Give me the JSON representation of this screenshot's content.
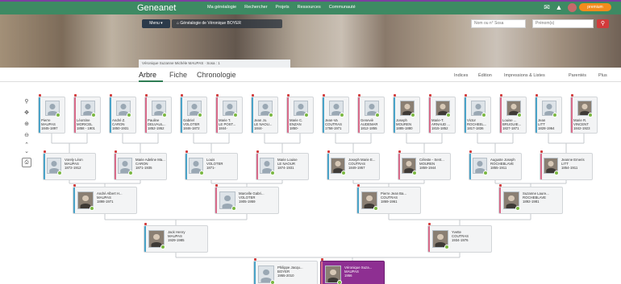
{
  "topbar": {
    "logo": "Geneanet",
    "nav": [
      "Ma généalogie",
      "Rechercher",
      "Projets",
      "Ressources",
      "Communauté"
    ],
    "premium": "premium"
  },
  "banner": {
    "menu_label": "Menu",
    "tree_title": "Généalogie de Véronique BOYER",
    "sosa_placeholder": "Nom ou n° Sosa",
    "prenom_placeholder": "Prénom(s)",
    "person_chip": "Véronique Suzanne Michèle MAUPAS · Sosa : 1"
  },
  "tabs": {
    "left": [
      "Arbre",
      "Fiche",
      "Chronologie"
    ],
    "right": [
      "Indices",
      "Édition",
      "Impressions & Listes",
      "Parentés",
      "Plus"
    ]
  },
  "tools": {
    "zoom_in": "⚲",
    "recenter": "✥",
    "zoom_plus": "⊕",
    "zoom_minus": "⊖",
    "up": "⌃",
    "down": "⌄",
    "print": "⎙"
  },
  "gen4": [
    {
      "l1": "Pierre",
      "l2": "MAUPAS",
      "l3": "1845-1897",
      "sex": "male"
    },
    {
      "l1": "Léontine",
      "l2": "MORICEL",
      "l3": "1858 - 1901",
      "sex": "female"
    },
    {
      "l1": "André Z.",
      "l2": "CARON",
      "l3": "1850-1931",
      "sex": "male"
    },
    {
      "l1": "Pauline",
      "l2": "DELVAUL...",
      "l3": "1852-1952",
      "sex": "female"
    },
    {
      "l1": "Gabriel",
      "l2": "VOLOTER",
      "l3": "1846-1872",
      "sex": "male"
    },
    {
      "l1": "Marie T.",
      "l2": "LE POST...",
      "l3": "1844-",
      "sex": "female"
    },
    {
      "l1": "Jean Jo.",
      "l2": "LE NAOU...",
      "l3": "1844-",
      "sex": "male"
    },
    {
      "l1": "Marie C.",
      "l2": "ENZAN",
      "l3": "1850-",
      "sex": "female"
    },
    {
      "l1": "Jean-Va",
      "l2": "COUTRAS",
      "l3": "1758-1971",
      "sex": "male"
    },
    {
      "l1": "Geneviè",
      "l2": "AUDEMAR",
      "l3": "1812-1855",
      "sex": "female"
    },
    {
      "l1": "Joseph",
      "l2": "MOUREN",
      "l3": "1885-1880",
      "sex": "male"
    },
    {
      "l1": "Marie-T.",
      "l2": "ARNAUD ...",
      "l3": "1815-1852",
      "sex": "female"
    },
    {
      "l1": "Victor",
      "l2": "ROCHEEL...",
      "l3": "1817-1836",
      "sex": "male"
    },
    {
      "l1": "Louise ...",
      "l2": "BRUGUIE...",
      "l3": "1827-1871",
      "sex": "female"
    },
    {
      "l1": "Jean",
      "l2": "LITT",
      "l3": "1828-1964",
      "sex": "male"
    },
    {
      "l1": "Marie R.",
      "l2": "VINCENT",
      "l3": "1842-1923",
      "sex": "female"
    }
  ],
  "gen3": [
    {
      "l1": "Vorely Léon",
      "l2": "MAUPAS",
      "l3": "1872-1912",
      "sex": "male"
    },
    {
      "l1": "Marie Adeline Ma...",
      "l2": "CARON",
      "l3": "1871-1935",
      "sex": "female"
    },
    {
      "l1": "Louis",
      "l2": "VOLOTER",
      "l3": "1871-",
      "sex": "male"
    },
    {
      "l1": "Marie Louise",
      "l2": "LE NAOUR",
      "l3": "1874-1931",
      "sex": "female"
    },
    {
      "l1": "Joseph Marie E...",
      "l2": "COUTRAS",
      "l3": "1849-1957",
      "sex": "male"
    },
    {
      "l1": "Céleste - Sent...",
      "l2": "MOUREN",
      "l3": "1859-1944",
      "sex": "female"
    },
    {
      "l1": "Auguste Joseph",
      "l2": "ROCHEBLAVE",
      "l3": "1855-1911",
      "sex": "male"
    },
    {
      "l1": "Jeanne Emeris",
      "l2": "LITT",
      "l3": "1854-1911",
      "sex": "female"
    }
  ],
  "gen2": [
    {
      "l1": "André Albert H...",
      "l2": "MAUPAS",
      "l3": "1898-1971",
      "sex": "male"
    },
    {
      "l1": "Marcelle Gabri...",
      "l2": "VOLOTER",
      "l3": "1905-1959",
      "sex": "female"
    },
    {
      "l1": "Pierre Jean Ba...",
      "l2": "COUTRAS",
      "l3": "1869-1961",
      "sex": "male"
    },
    {
      "l1": "Suzanne Laure...",
      "l2": "ROCHEBLAVE",
      "l3": "1892-1981",
      "sex": "female"
    }
  ],
  "gen1": [
    {
      "l1": "Jack Henry",
      "l2": "MAUPAS",
      "l3": "1929-1985",
      "sex": "male"
    },
    {
      "l1": "Yvette",
      "l2": "COUTRAS",
      "l3": "1934-1976",
      "sex": "female"
    }
  ],
  "gen0": [
    {
      "l1": "Philippe Jacqu...",
      "l2": "BOYER",
      "l3": "1955-2010",
      "sex": "male"
    },
    {
      "l1": "Véronique Suza...",
      "l2": "MAUPAS",
      "l3": "1956",
      "sex": "female"
    }
  ]
}
